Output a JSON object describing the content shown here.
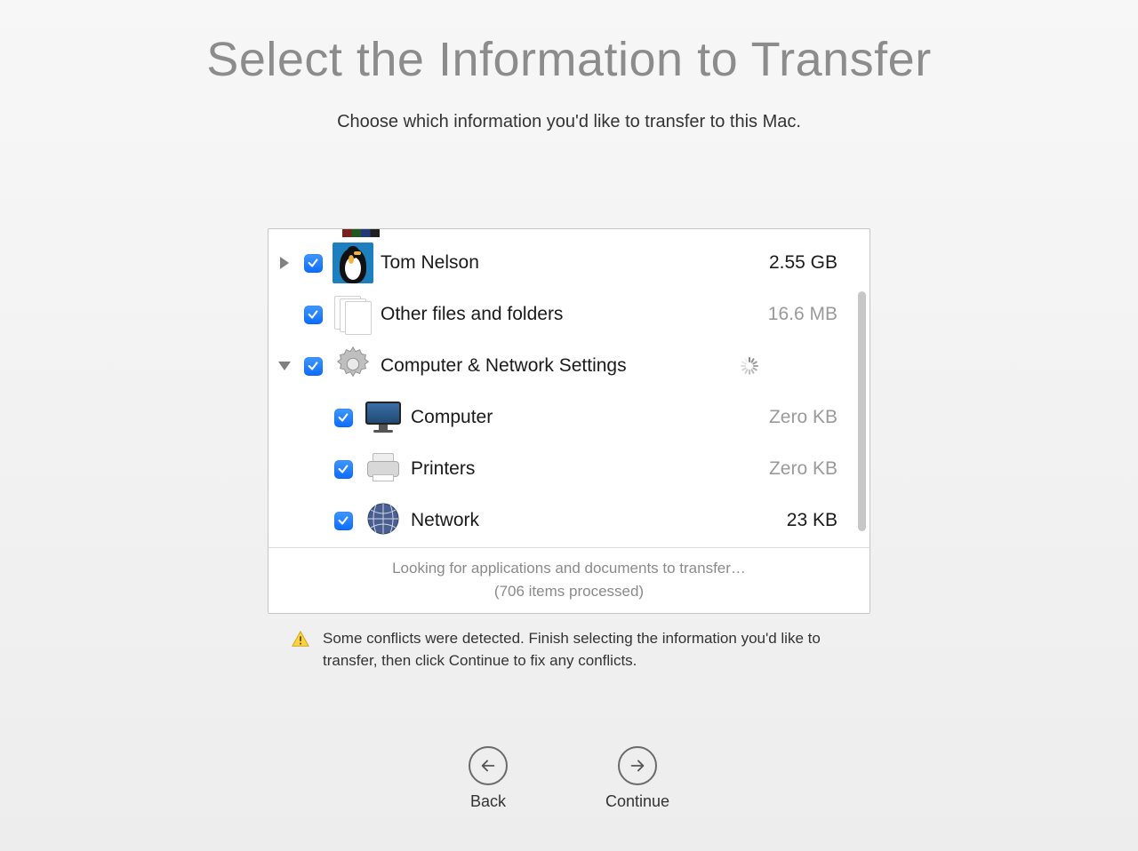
{
  "title": "Select the Information to Transfer",
  "subtitle": "Choose which information you'd like to transfer to this Mac.",
  "items": [
    {
      "label": "Tom Nelson",
      "size": "2.55 GB",
      "size_muted": false
    },
    {
      "label": "Other files and folders",
      "size": "16.6 MB",
      "size_muted": true
    },
    {
      "label": "Computer & Network Settings",
      "size": "",
      "size_muted": false
    },
    {
      "label": "Computer",
      "size": "Zero KB",
      "size_muted": true
    },
    {
      "label": "Printers",
      "size": "Zero KB",
      "size_muted": true
    },
    {
      "label": "Network",
      "size": "23 KB",
      "size_muted": false
    }
  ],
  "status": {
    "line1": "Looking for applications and documents to transfer…",
    "line2": "(706 items processed)"
  },
  "warning": "Some conflicts were detected. Finish selecting the information you'd like to transfer, then click Continue to fix any conflicts.",
  "nav": {
    "back": "Back",
    "continue": "Continue"
  }
}
